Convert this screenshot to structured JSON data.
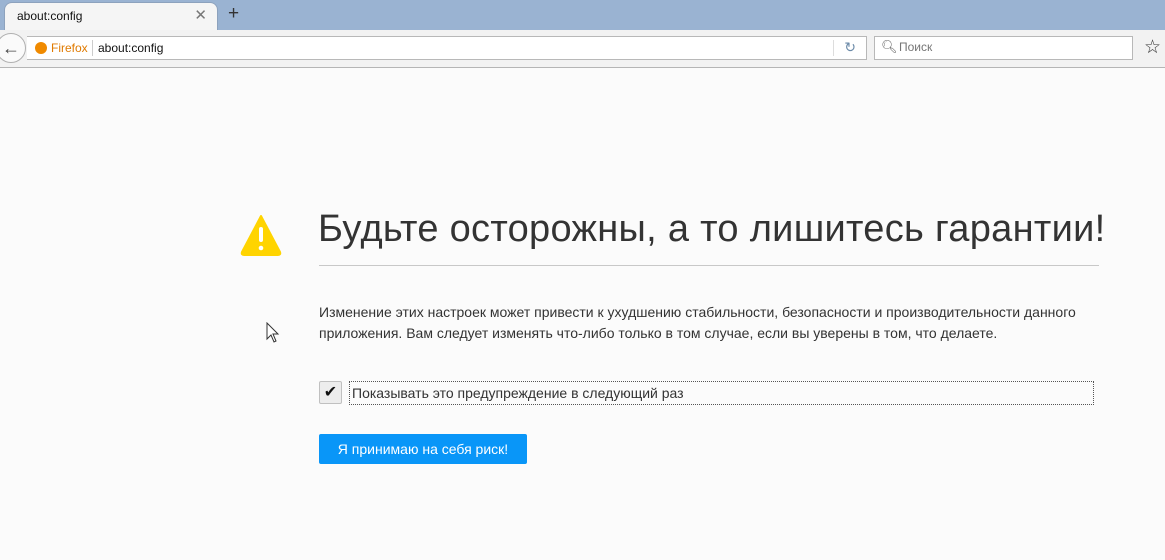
{
  "tab": {
    "title": "about:config"
  },
  "navbar": {
    "identity": "Firefox",
    "url": "about:config",
    "search_placeholder": "Поиск"
  },
  "page": {
    "title": "Будьте осторожны, а то лишитесь гарантии!",
    "description": "Изменение этих настроек может привести к ухудшению стабильности, безопасности и производительности данного приложения. Вам следует изменять что-либо только в том случае, если вы уверены в том, что делаете.",
    "checkbox_label": "Показывать это предупреждение в следующий раз",
    "checkbox_checked": true,
    "accept_button": "Я принимаю на себя риск!"
  },
  "colors": {
    "accent": "#0996f8",
    "warning": "#ffd400"
  }
}
